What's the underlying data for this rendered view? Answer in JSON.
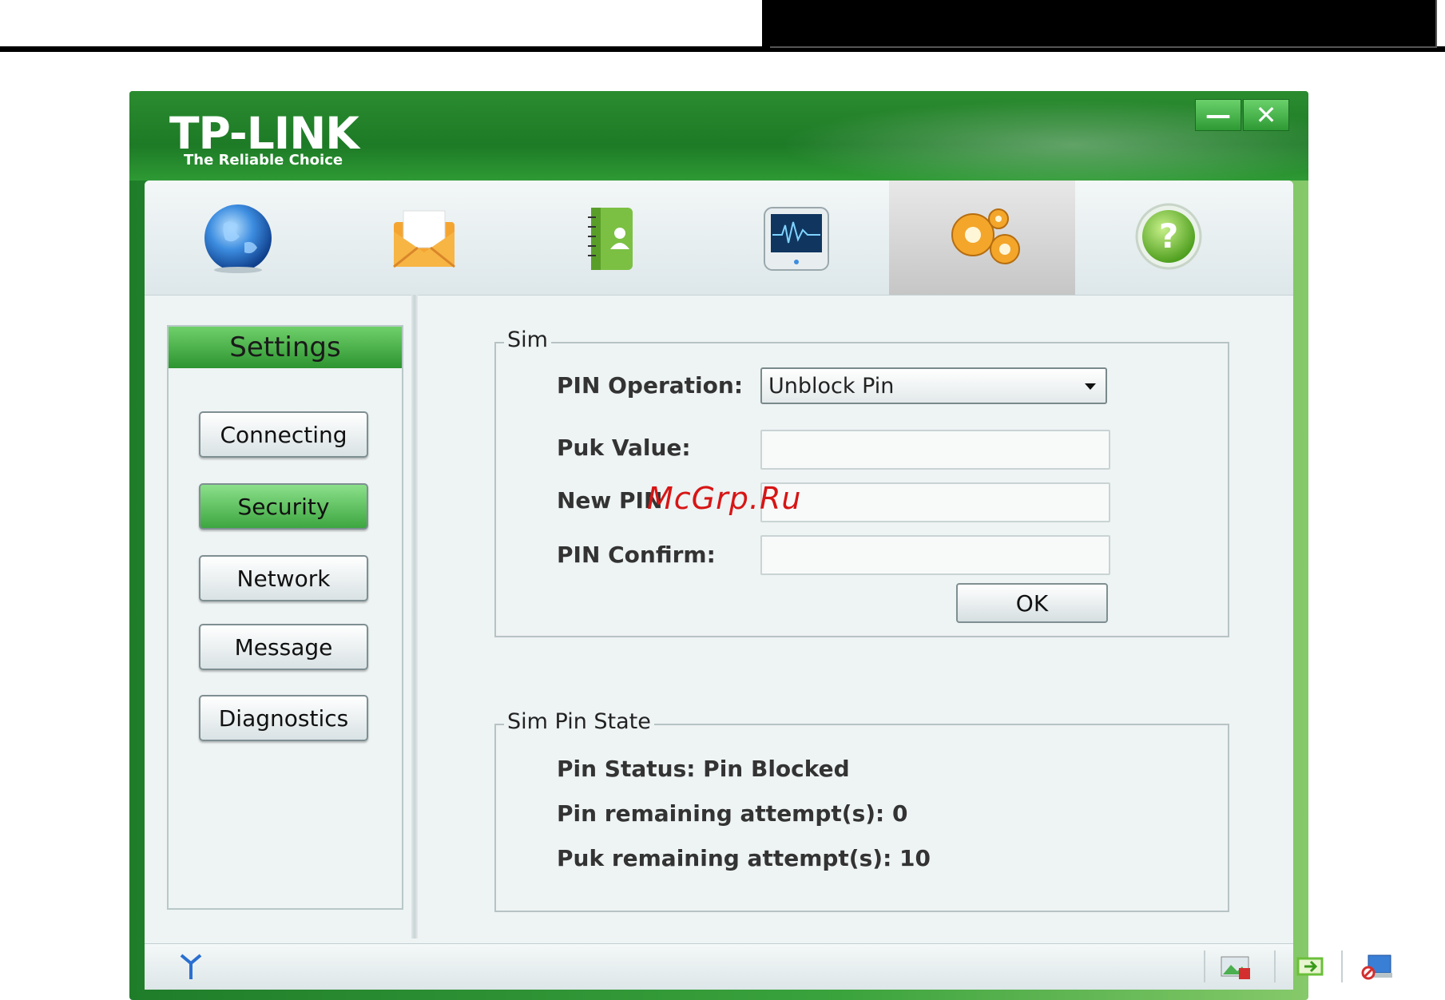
{
  "app": {
    "brand": "TP-LINK",
    "tagline": "The Reliable Choice",
    "window_controls": {
      "minimize": "—",
      "close": "✕"
    }
  },
  "toolbar": {
    "tabs": [
      {
        "icon": "globe-icon"
      },
      {
        "icon": "envelope-icon"
      },
      {
        "icon": "contacts-book-icon"
      },
      {
        "icon": "monitor-icon"
      },
      {
        "icon": "gears-icon",
        "active": true
      },
      {
        "icon": "help-icon",
        "glyph": "?"
      }
    ]
  },
  "sidebar": {
    "title": "Settings",
    "items": [
      {
        "label": "Connecting"
      },
      {
        "label": "Security",
        "active": true
      },
      {
        "label": "Network"
      },
      {
        "label": "Message"
      },
      {
        "label": "Diagnostics"
      }
    ]
  },
  "sim": {
    "legend": "Sim",
    "pin_operation_label": "PIN Operation:",
    "pin_operation_value": "Unblock Pin",
    "puk_value_label": "Puk Value:",
    "puk_value": "",
    "new_pin_label": "New PIN",
    "new_pin_value": "",
    "pin_confirm_label": "PIN Confirm:",
    "pin_confirm_value": "",
    "ok_label": "OK"
  },
  "sim_pin_state": {
    "legend": "Sim Pin State",
    "pin_status": "Pin Status: Pin Blocked",
    "pin_remaining": "Pin remaining attempt(s): 0",
    "puk_remaining": "Puk remaining attempt(s): 10"
  },
  "watermark": "McGrp.Ru",
  "status_bar": {
    "icons": [
      "signal-antenna-icon",
      "roaming-image-icon",
      "battery-icon",
      "network-monitor-icon"
    ]
  },
  "colors": {
    "brand_green": "#1f7d2a",
    "accent_green": "#3da640",
    "watermark_red": "#d71515"
  }
}
